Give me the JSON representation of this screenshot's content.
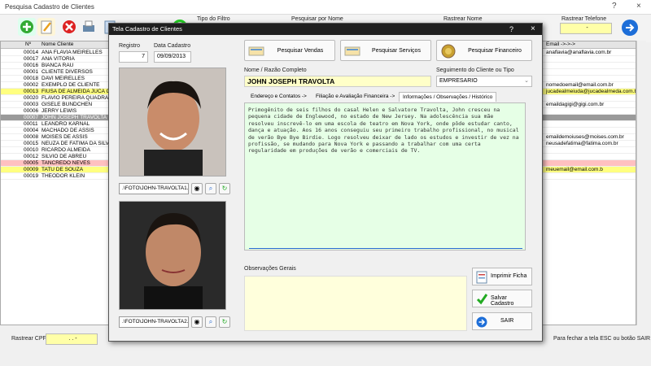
{
  "bg_window": {
    "title": "Pesquisa Cadastro de Clientes",
    "controls": [
      "?",
      "×"
    ],
    "toolbar": {
      "tipo_filtro_label": "Tipo do Filtro",
      "pesquisar_nome_label": "Pesquisar por Nome",
      "rastrear_nome_label": "Rastrear Nome",
      "rastrear_telefone_label": "Rastrear Telefone",
      "rastrear_telefone_value": "-"
    },
    "grid": {
      "headers": [
        "Nº",
        "Nome Cliente",
        "Email ->->->"
      ],
      "rows": [
        {
          "num": "00014",
          "name": "ANA FLAVIA MEIRELLES",
          "email": "anaflavia@anaflavia.com.br",
          "style": "normal"
        },
        {
          "num": "00017",
          "name": "ANA VITÓRIA",
          "email": "",
          "style": "normal"
        },
        {
          "num": "00016",
          "name": "BIANCA RAU",
          "email": "",
          "style": "normal"
        },
        {
          "num": "00001",
          "name": "CLIENTE DIVERSOS",
          "email": "",
          "style": "normal"
        },
        {
          "num": "00018",
          "name": "DAVI MEIRELLES",
          "email": "",
          "style": "normal"
        },
        {
          "num": "00002",
          "name": "EXEMPLO DE CLIENTE",
          "email": "nomedoemail@email.com.br",
          "style": "normal"
        },
        {
          "num": "00013",
          "name": "FIUSA DE ALMEIDA JUCA C",
          "email": "jucadealmeiuda@jucadealmeda.com.br",
          "style": "yellow"
        },
        {
          "num": "00020",
          "name": "FLAVIO PEREIRA QUADRAD",
          "email": "",
          "style": "normal"
        },
        {
          "num": "00003",
          "name": "GISELE BUNDCHEN",
          "email": "emaildagigi@gigi.com.br",
          "style": "normal"
        },
        {
          "num": "00006",
          "name": "JERRY LEWIS",
          "email": "",
          "style": "normal"
        },
        {
          "num": "00007",
          "name": "JOHN JOSEPH TRAVOLTA",
          "email": "",
          "style": "selected"
        },
        {
          "num": "00011",
          "name": "LEANDRO KARNAL",
          "email": "",
          "style": "normal"
        },
        {
          "num": "00004",
          "name": "MACHADO DE ASSIS",
          "email": "",
          "style": "normal"
        },
        {
          "num": "00008",
          "name": "MOISES DE ASSIS",
          "email": "emaildemoiuses@moises.com.br",
          "style": "normal"
        },
        {
          "num": "00015",
          "name": "NEUZA DE FATIMA DA SILV",
          "email": "neusadefatima@fatima.com.br",
          "style": "normal"
        },
        {
          "num": "00010",
          "name": "RICARDO ALMEIDA",
          "email": "",
          "style": "normal"
        },
        {
          "num": "00012",
          "name": "SILVIO DE ABREU",
          "email": "",
          "style": "normal"
        },
        {
          "num": "00005",
          "name": "TANCREDO NEVES",
          "email": "",
          "style": "pink"
        },
        {
          "num": "00009",
          "name": "TATU DE SOUZA",
          "email": "meuemail@email.com.b",
          "style": "yellow"
        },
        {
          "num": "00019",
          "name": "THEODOR KLEIN",
          "email": "",
          "style": "normal"
        }
      ]
    },
    "bottom": {
      "rastrear_cpf_label": "Rastrear CPF",
      "rastrear_cpf_value": ". . -",
      "hint": "Para fechar a tela ESC ou botão SAIR"
    }
  },
  "modal": {
    "title": "Tela Cadastro de Clientes",
    "controls": [
      "?",
      "×"
    ],
    "registro_label": "Registro",
    "registro_value": "7",
    "data_cadastro_label": "Data Cadastro",
    "data_cadastro_value": "09/09/2013",
    "btn_vendas": "Pesquisar Vendas",
    "btn_servicos": "Pesquisar Serviços",
    "btn_financeiro": "Pesquisar  Financeiro",
    "nome_label": "Nome / Razão Completo",
    "nome_value": "JOHN JOSEPH TRAVOLTA",
    "segmento_label": "Seguimento do Cliente ou Tipo",
    "segmento_value": "EMPRESARIO",
    "tabs": [
      "Endereço e Contatos ->",
      "Filiação e Avaliação Financeira ->",
      "Informações / Observações / Histórico"
    ],
    "notes": "Primogênito de seis filhos do casal Helen e Salvatore Travolta, John cresceu na pequena cidade de Englewood, no estado de New Jersey. Na adolescência sua mãe resolveu inscrevê-lo em uma escola de teatro em Nova York, onde pôde estudar canto, dança e atuação. Aos 16 anos conseguiu seu primeiro trabalho profissional, no musical de verão Bye Bye Birdie. Logo resolveu deixar de lado os estudos e investir de vez na profissão, se mudando para Nova York e passando a trabalhar com uma certa regularidade em produções de verão e comerciais de TV.",
    "photo1_path": ".\\FOTO\\JOHN-TRAVOLTA1.",
    "photo2_path": ".\\FOTO\\JOHN-TRAVOLTA2.",
    "obs_gerais_label": "Observações Gerais",
    "btn_imprimir": "Imprimir Ficha",
    "btn_salvar": "Salvar Cadastro",
    "btn_sair": "SAIR"
  },
  "colors": {
    "yellow_field": "#ffffa8",
    "notes_bg": "#e6ffe6",
    "selected_row": "#9a9a9a",
    "yellow_row": "#ffff80",
    "pink_row": "#ffc0c0",
    "modal_title_bg": "#1f1f1f"
  }
}
